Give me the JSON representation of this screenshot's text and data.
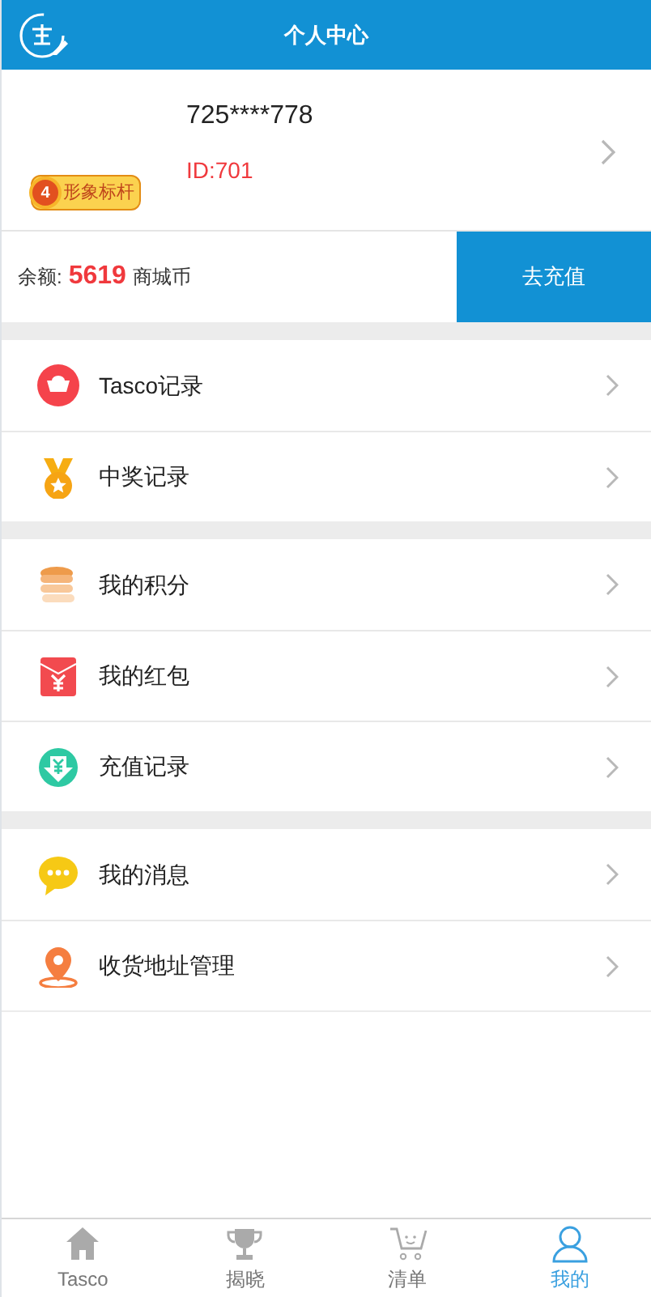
{
  "header": {
    "title": "个人中心"
  },
  "profile": {
    "username": "725****778",
    "user_id": "ID:701",
    "badge": {
      "level": "4",
      "label": "形象标杆"
    }
  },
  "balance": {
    "label": "余额:",
    "amount": "5619",
    "unit": "商城币",
    "button": "去充值"
  },
  "menu_groups": [
    [
      {
        "label": "Tasco记录",
        "kind": "ingot"
      },
      {
        "label": "中奖记录",
        "kind": "medal"
      }
    ],
    [
      {
        "label": "我的积分",
        "kind": "coins"
      },
      {
        "label": "我的红包",
        "kind": "envelope"
      },
      {
        "label": "充值记录",
        "kind": "recharge"
      }
    ],
    [
      {
        "label": "我的消息",
        "kind": "message"
      },
      {
        "label": "收货地址管理",
        "kind": "location"
      }
    ]
  ],
  "bottom_nav": [
    {
      "label": "Tasco",
      "kind": "home",
      "selected": false
    },
    {
      "label": "揭晓",
      "kind": "trophy",
      "selected": false
    },
    {
      "label": "清单",
      "kind": "cart",
      "selected": false
    },
    {
      "label": "我的",
      "kind": "user",
      "selected": true
    }
  ]
}
